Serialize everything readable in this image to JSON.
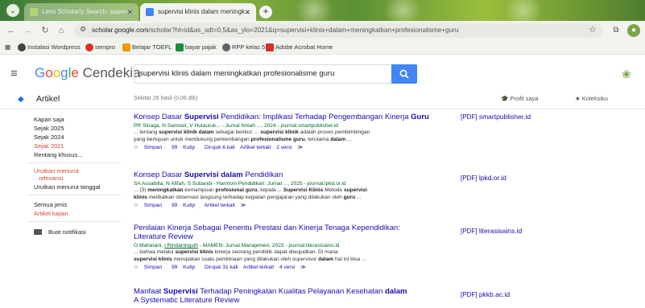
{
  "browser": {
    "tabs": [
      {
        "title": "Lens Scholarly Search: supervi..."
      },
      {
        "title": "supervisi klinis dalam meningk..."
      }
    ],
    "url_domain": "scholar.google.com",
    "url_path": "/scholar?hl=id&as_sdt=0,5&as_ylo=2021&q=supervisi+klinis+dalam+meningkatkan+profesionalisme+guru",
    "bookmarks": [
      {
        "label": "Instalasi Wordpress"
      },
      {
        "label": "sempro"
      },
      {
        "label": "Belajar TOEFL"
      },
      {
        "label": "bayar pajak"
      },
      {
        "label": "RPP kelas 5"
      },
      {
        "label": "Adobe Acrobat Home"
      }
    ]
  },
  "header": {
    "logo_google": [
      "G",
      "o",
      "o",
      "g",
      "l",
      "e"
    ],
    "logo_suffix": "Cendekia",
    "search_value": "supervisi klinis dalam meningkatkan profesionalisme guru"
  },
  "subbar": {
    "section_label": "Artikel",
    "results_count": "Sekitar 26 hasil (0,06 dtk)",
    "profile_label": "Profil saya",
    "library_label": "Koleksiku"
  },
  "sidebar": {
    "time_filters": [
      "Kapan saja",
      "Sejak 2025",
      "Sejak 2024",
      "Sejak 2021",
      "Rentang khusus..."
    ],
    "sort_relevance_1": "Urutkan menurut",
    "sort_relevance_2": "relevansi",
    "sort_date": "Urutkan menurut tanggal",
    "type_all": "Semua jenis",
    "type_review": "Artikel kajian",
    "create_alert": "Buat notifikasi"
  },
  "results": [
    {
      "title_pre": "Konsep Dasar ",
      "title_b1": "Supervisi",
      "title_mid": " Pendidikan: Implikasi Terhadap Pengembangan Kinerja ",
      "title_b2": "Guru",
      "authors": "PR Sinaga, N Samosir, V Hutauruk... - Jurnal Ilmiah ..., 2024 - journal.smartpublisher.id",
      "snippet_1": "... tentang supervisi klinik dalam sebagai berikut: ... supervisi klinik adalah proses pembimbingan",
      "snippet_2": "yang bertujuan untuk mendukung perkembangan profesionalisme guru, terutama dalam ...",
      "save": "Simpan",
      "cite": "Kutip",
      "cited_by": "Dirujuk 6 kali",
      "related": "Artikel terkait",
      "versions": "2 versi",
      "pdf_tag": "[PDF]",
      "pdf_domain": "smartpublisher.id"
    },
    {
      "title_pre": "Konsep Dasar ",
      "title_b1": "Supervisi dalam",
      "title_mid": " Pendidikan",
      "title_b2": "",
      "authors": "SA Assabilla, N Afifah, S Subandi - Harmoni Pendidikan: Jurnal ..., 2025 - journal.lpkd.or.id",
      "snippet_1": "... (3) meningkatkan kemampuan profesional guru, kepala ... Supervisi Klinis Metode supervisi",
      "snippet_2": "klinis melibatkan observasi langsung terhadap kegiatan pengajaran yang dilakukan oleh guru ...",
      "save": "Simpan",
      "cite": "Kutip",
      "cited_by": "",
      "related": "Artikel terkait",
      "versions": "",
      "pdf_tag": "[PDF]",
      "pdf_domain": "lpkd.or.id"
    },
    {
      "title_pre": "Penilaian Kinerja Sebagai Penentu Prestasi dan Kinerja Tenaga Kependidikan:",
      "title_b1": "",
      "title_mid": " Literature Review",
      "title_b2": "",
      "authors": "O Maharani, I Rindaningsih - MAMEN: Jurnal Manajemen, 2023 - journal.literasisains.id",
      "snippet_1": "... bahwa melalui supervisi klinis kinerja seorang pendidik dapat diwujudkan. Di mana",
      "snippet_2": "supervisi klinis merupakan suatu pembinaan yang dilakukan oleh supervisor dalam hal ini bisa ...",
      "save": "Simpan",
      "cite": "Kutip",
      "cited_by": "Dirujuk 31 kali",
      "related": "Artikel terkait",
      "versions": "4 versi",
      "pdf_tag": "[PDF]",
      "pdf_domain": "literasisains.id"
    },
    {
      "title_pre": "Manfaat ",
      "title_b1": "Supervisi",
      "title_mid": " Terhadap Peningkatan Kualitas Pelayanan Kesehatan ",
      "title_b2": "dalam",
      "title_line2": "A Systematic Literature Review",
      "pdf_tag": "[PDF]",
      "pdf_domain": "pkkb.ac.id"
    }
  ]
}
